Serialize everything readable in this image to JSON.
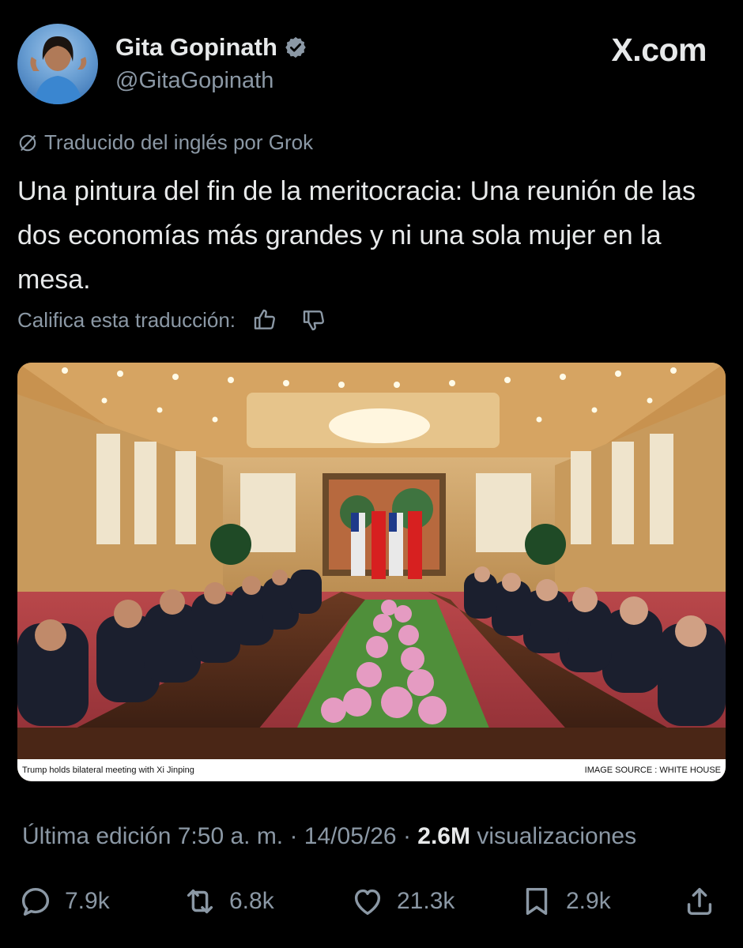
{
  "author": {
    "display_name": "Gita Gopinath",
    "handle": "@GitaGopinath",
    "verified": true
  },
  "brand": "X.com",
  "translation_note": "Traducido del inglés por Grok",
  "tweet_text": "Una pintura del fin de la meritocracia: Una reunión de las dos economías más grandes y ni una sola mujer en la mesa.",
  "rate_label": "Califica esta traducción:",
  "image": {
    "caption_left": "Trump holds bilateral meeting with Xi Jinping",
    "caption_right": "IMAGE SOURCE : WHITE HOUSE"
  },
  "meta": {
    "edited": "Última edición 7:50 a. m. · 14/05/26",
    "views_count": "2.6M",
    "views_label": "visualizaciones"
  },
  "actions": {
    "replies": "7.9k",
    "reposts": "6.8k",
    "likes": "21.3k",
    "bookmarks": "2.9k"
  },
  "colors": {
    "background": "#000000",
    "text_primary": "#e7e9ea",
    "text_secondary": "#8b98a5"
  }
}
